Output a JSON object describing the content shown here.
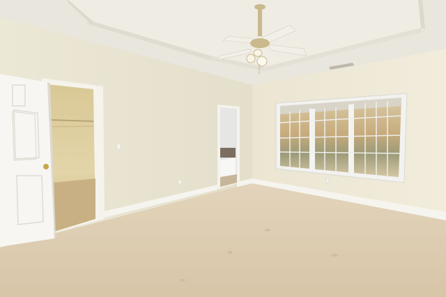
{
  "scene": {
    "type": "photo",
    "subject": "empty-bedroom",
    "colors": {
      "ceiling": "#ebe8df",
      "wall_left": "#e9e5d3",
      "wall_right": "#efe9d8",
      "carpet": "#dccbb0",
      "trim": "#f6f4ee",
      "closet_wall": "#dccd9c",
      "door": "#f7f6f2",
      "window_frame": "#f1f1ef",
      "window_view": "#c9b58f",
      "fan_blade": "#f2efe8",
      "fan_metal": "#c9b98c"
    }
  }
}
